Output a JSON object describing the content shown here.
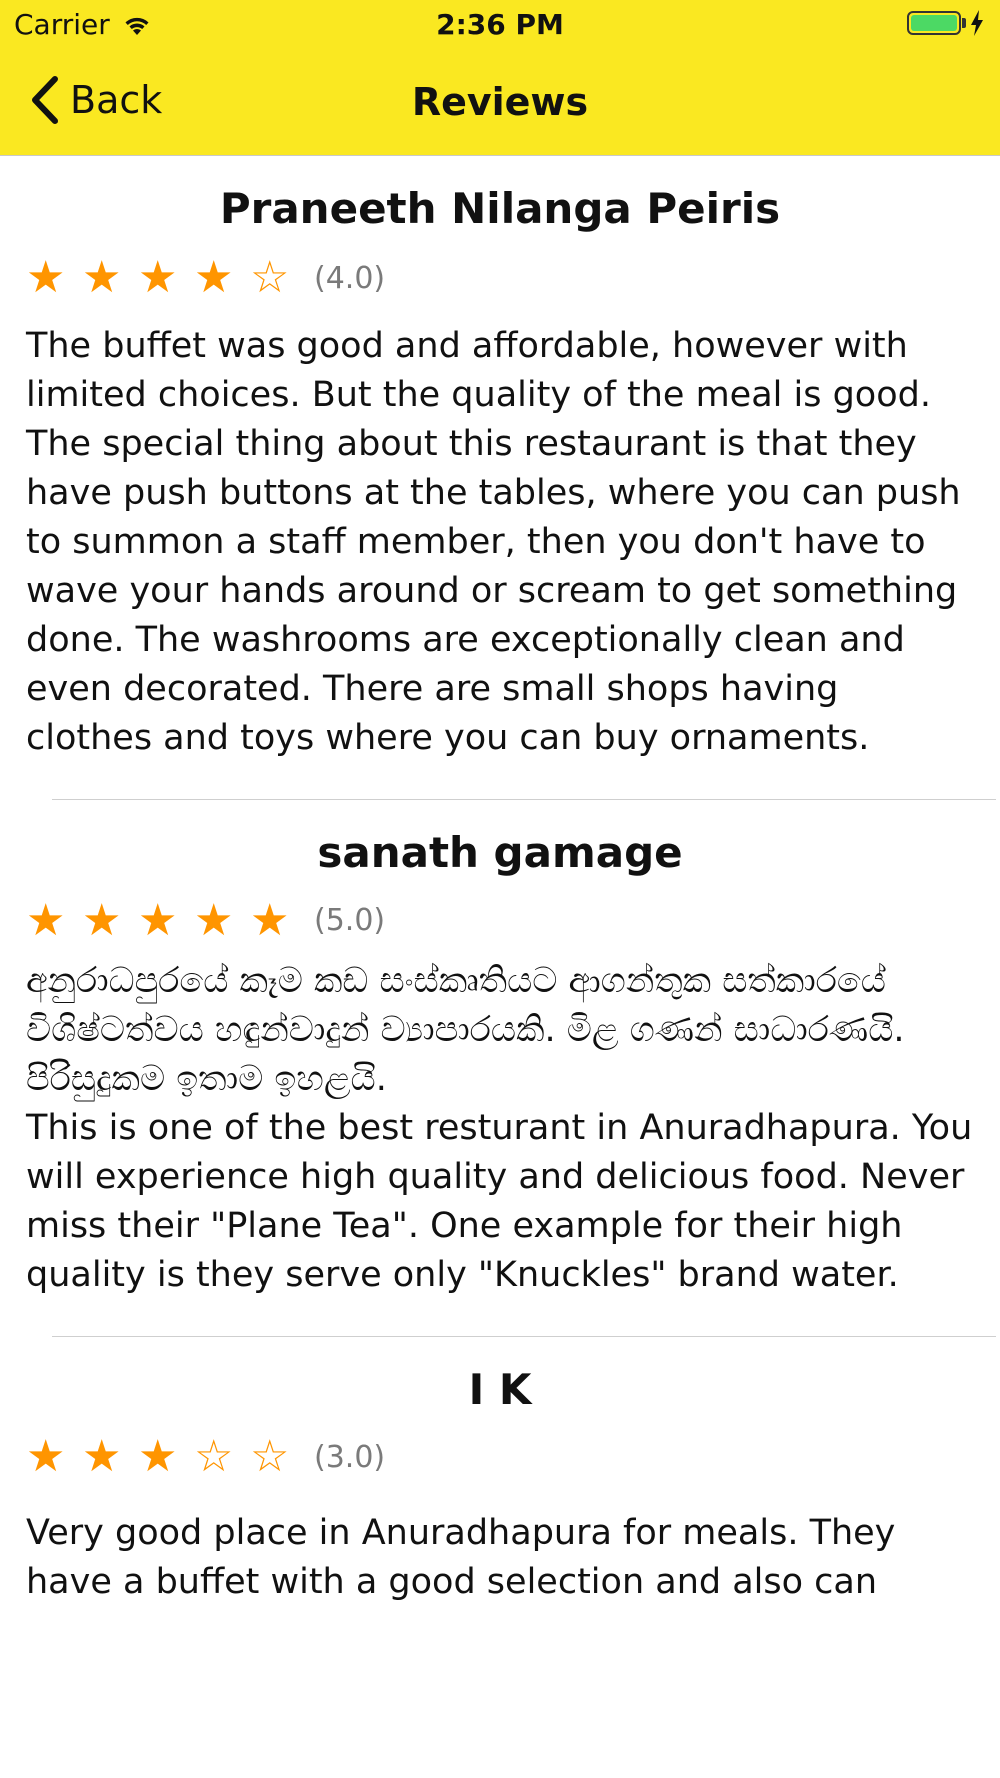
{
  "status_bar": {
    "carrier": "Carrier",
    "time": "2:36 PM",
    "battery_level": 1.0,
    "charging": true
  },
  "nav": {
    "back_label": "Back",
    "title": "Reviews"
  },
  "colors": {
    "nav_background": "#FAE821",
    "star": "#FF9500",
    "rating_text": "#7a7a7a",
    "battery": "#4CD964"
  },
  "reviews": [
    {
      "author": "Praneeth Nilanga Peiris",
      "rating": 4,
      "rating_label": "(4.0)",
      "text": "The buffet was good and affordable, however with limited choices. But the quality of the meal is good. The special thing about this restaurant is that they have push buttons at the tables, where you can push to summon a staff member, then you don't have to wave your hands around or scream to get something done. The washrooms are exceptionally clean and even decorated. There are small shops having clothes and toys where you can buy ornaments."
    },
    {
      "author": "sanath gamage",
      "rating": 5,
      "rating_label": "(5.0)",
      "text": "අනුරාධපුරයේ කෑම කඩ සංස්කෘතියට ආගන්තුක සත්කාරයේ විශිෂ්ටත්වය හඳුන්වාදුන් ව්‍යාපාරයකි. මිළ ගණන් සාධාරණයි. පිරිසුදුකම ඉතාම ඉහළයි.\nThis is one of the best resturant in Anuradhapura. You will experience high quality and delicious food. Never miss their \"Plane Tea\". One example for their high quality is they serve only \"Knuckles\" brand water."
    },
    {
      "author": "I K",
      "rating": 3,
      "rating_label": "(3.0)",
      "text": "Very good place in Anuradhapura for meals. They have a buffet with a good selection and also can"
    }
  ]
}
